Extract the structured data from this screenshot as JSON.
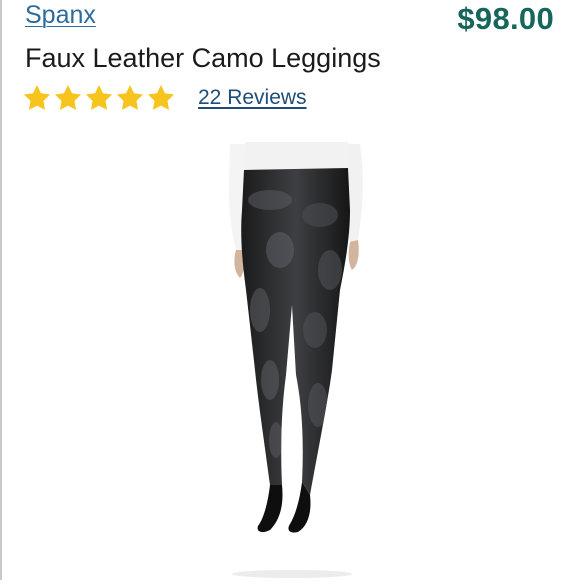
{
  "listing": {
    "brand": "Spanx",
    "price": "$98.00",
    "title": "Faux Leather Camo Leggings",
    "rating": {
      "stars": 5,
      "max": 5
    },
    "reviews_label": "22 Reviews"
  },
  "colors": {
    "brand_link": "#2d6b9c",
    "price": "#17665b",
    "star": "#f7c41d",
    "reviews_link": "#1e4d78"
  }
}
